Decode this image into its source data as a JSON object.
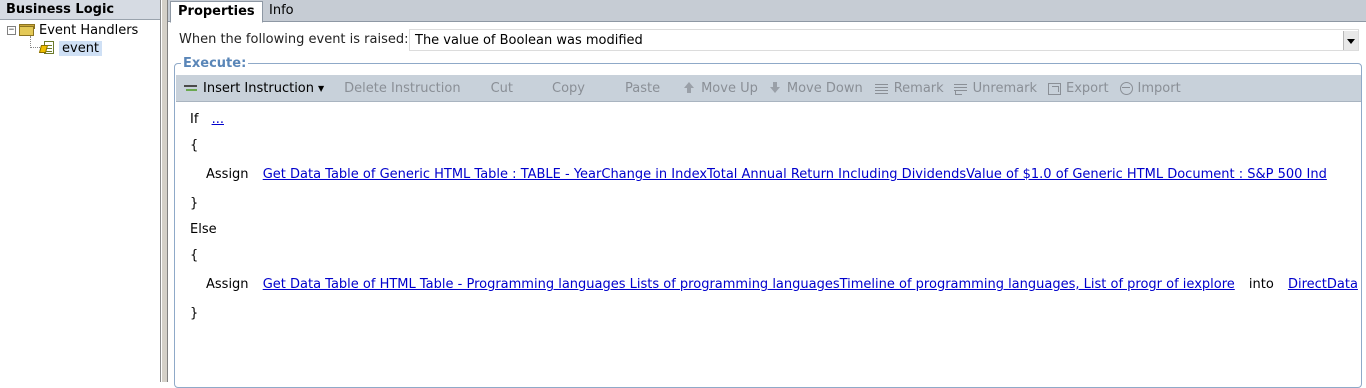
{
  "left_panel": {
    "title": "Business Logic",
    "tree": {
      "root_toggle": "−",
      "root_label": "Event Handlers",
      "child_label": "event"
    }
  },
  "tabs": [
    {
      "label": "Properties",
      "active": true
    },
    {
      "label": "Info",
      "active": false
    }
  ],
  "event": {
    "label": "When the following event is raised:",
    "value": "The value of Boolean was modified"
  },
  "execute": {
    "legend": "Execute:",
    "toolbar": [
      {
        "label": "Insert Instruction",
        "enabled": true,
        "icon": "insert-icon"
      },
      {
        "label": "Delete Instruction",
        "enabled": false
      },
      {
        "label": "Cut",
        "enabled": false
      },
      {
        "label": "Copy",
        "enabled": false
      },
      {
        "label": "Paste",
        "enabled": false
      },
      {
        "label": "Move Up",
        "enabled": false,
        "icon": "move-up-icon"
      },
      {
        "label": "Move Down",
        "enabled": false,
        "icon": "move-down-icon"
      },
      {
        "label": "Remark",
        "enabled": false,
        "icon": "remark-icon"
      },
      {
        "label": "Unremark",
        "enabled": false,
        "icon": "unremark-icon"
      },
      {
        "label": "Export",
        "enabled": false,
        "icon": "export-icon"
      },
      {
        "label": "Import",
        "enabled": false,
        "icon": "import-icon"
      }
    ],
    "code": {
      "if_kw": "If",
      "if_condition": "...",
      "open_brace_1": "{",
      "assign_kw_1": "Assign",
      "assign_link_1": "Get Data Table of Generic HTML Table : TABLE - YearChange in IndexTotal Annual Return Including DividendsValue of $1.0 of Generic HTML Document : S&P 500 Ind",
      "close_brace_1": "}",
      "else_kw": "Else",
      "open_brace_2": "{",
      "assign_kw_2": "Assign",
      "assign_link_2": "Get Data Table of HTML Table - Programming languages Lists of programming languagesTimeline of programming languages, List of progr of iexplore",
      "into_kw": "into",
      "into_link": "DirectData",
      "close_brace_2": "}"
    }
  }
}
